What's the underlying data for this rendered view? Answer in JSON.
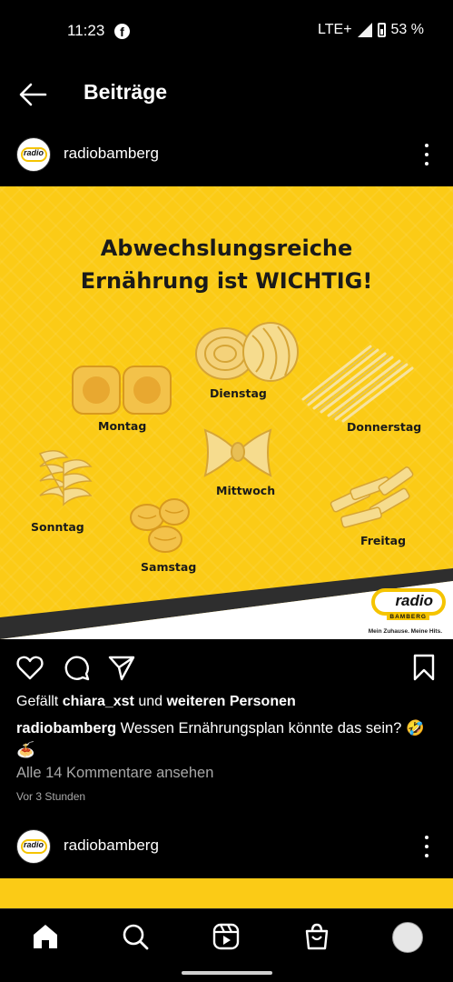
{
  "status_bar": {
    "time": "11:23",
    "facebook_icon": "facebook-icon",
    "network": "LTE+",
    "battery": "53 %"
  },
  "header": {
    "title": "Beiträge"
  },
  "post": {
    "username": "radiobamberg",
    "image": {
      "title_line1": "Abwechslungsreiche",
      "title_line2": "Ernährung ist WICHTIG!",
      "days": {
        "montag": "Montag",
        "dienstag": "Dienstag",
        "mittwoch": "Mittwoch",
        "donnerstag": "Donnerstag",
        "freitag": "Freitag",
        "samstag": "Samstag",
        "sonntag": "Sonntag"
      },
      "brand_logo_text": "radio",
      "brand_logo_subtext": "BAMBERG",
      "brand_slogan": "Mein Zuhause. Meine Hits.",
      "background_color": "#fbcb16"
    },
    "likes": {
      "prefix": "Gefällt",
      "user": "chiara_xst",
      "middle": "und",
      "suffix": "weiteren Personen"
    },
    "caption": {
      "username": "radiobamberg",
      "text": "Wessen Ernährungsplan könnte das sein? 🤣🍝"
    },
    "comments_link": "Alle 14 Kommentare ansehen",
    "timestamp": "Vor 3 Stunden"
  },
  "next_post": {
    "username": "radiobamberg"
  },
  "nav": {
    "items": [
      "home-icon",
      "search-icon",
      "reels-icon",
      "shop-icon",
      "profile-avatar"
    ]
  }
}
